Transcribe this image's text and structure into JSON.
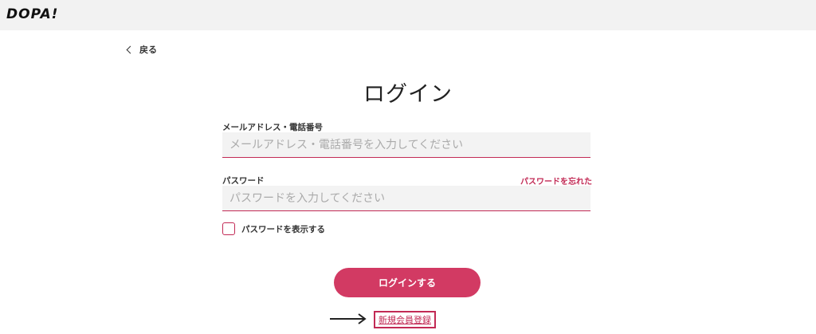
{
  "header": {
    "logo_text": "DOPA!"
  },
  "nav": {
    "back_label": "戻る"
  },
  "page": {
    "title": "ログイン"
  },
  "form": {
    "id_label": "メールアドレス・電話番号",
    "id_placeholder": "メールアドレス・電話番号を入力してください",
    "id_value": "",
    "password_label": "パスワード",
    "password_placeholder": "パスワードを入力してください",
    "password_value": "",
    "forgot_password": "パスワードを忘れた",
    "show_password_label": "パスワードを表示する",
    "show_password_checked": false,
    "login_button": "ログインする",
    "register_link": "新規会員登録"
  },
  "colors": {
    "accent": "#c22a55",
    "button": "#d23a63",
    "header_bg": "#f2f2f2",
    "field_bg": "#f3f3f3"
  },
  "icons": {
    "back": "chevron-left-icon",
    "arrow": "arrow-right-icon"
  }
}
